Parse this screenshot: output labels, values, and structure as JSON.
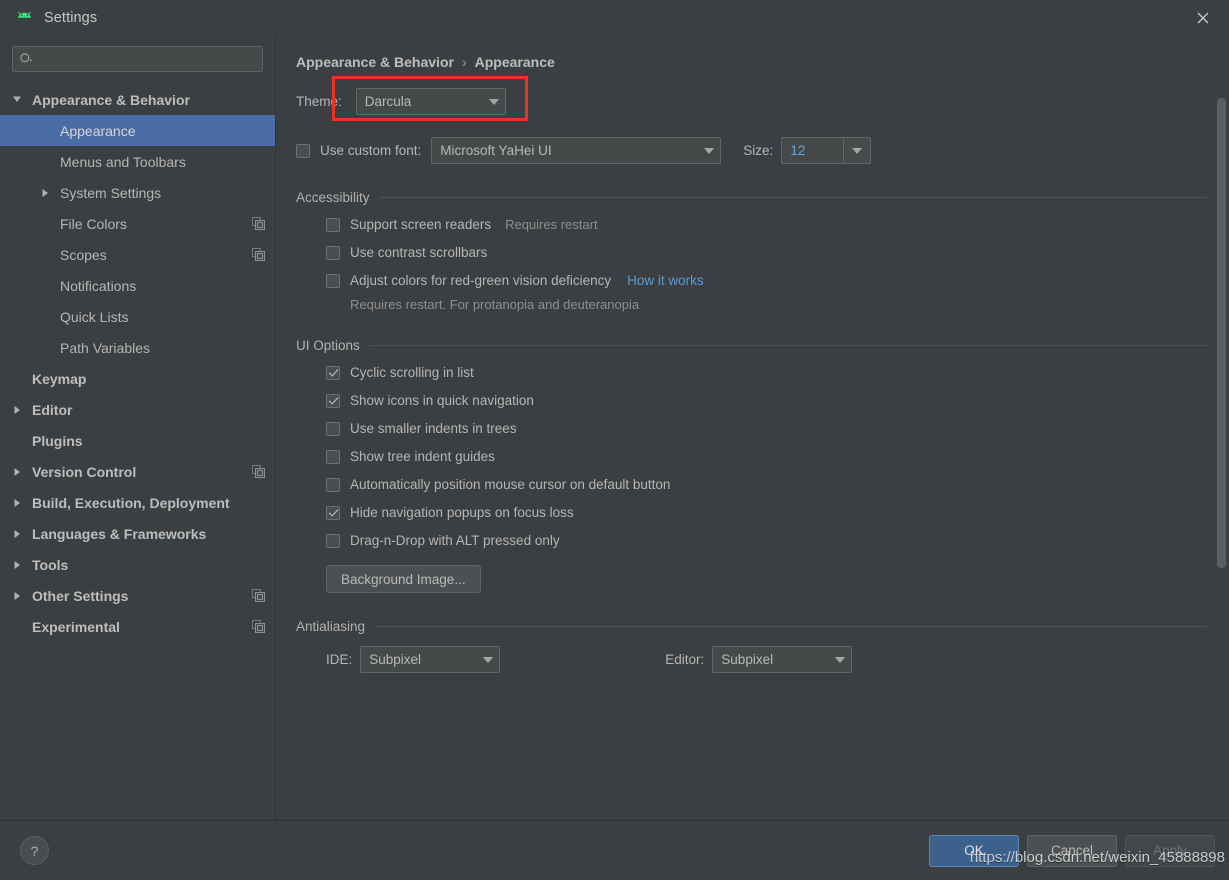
{
  "window": {
    "title": "Settings",
    "app_icon": "android-robot-icon",
    "close_icon": "close-icon"
  },
  "search": {
    "placeholder": "",
    "value": "",
    "icon": "search-icon"
  },
  "sidebar": {
    "items": [
      {
        "label": "Appearance & Behavior",
        "indent": 0,
        "twisty": "expanded",
        "bold": true,
        "selected": false,
        "trailing_icon": ""
      },
      {
        "label": "Appearance",
        "indent": 1,
        "twisty": "none",
        "bold": false,
        "selected": true,
        "trailing_icon": ""
      },
      {
        "label": "Menus and Toolbars",
        "indent": 1,
        "twisty": "none",
        "bold": false,
        "selected": false,
        "trailing_icon": ""
      },
      {
        "label": "System Settings",
        "indent": 1,
        "twisty": "collapsed",
        "bold": false,
        "selected": false,
        "trailing_icon": ""
      },
      {
        "label": "File Colors",
        "indent": 1,
        "twisty": "none",
        "bold": false,
        "selected": false,
        "trailing_icon": "copy-icon"
      },
      {
        "label": "Scopes",
        "indent": 1,
        "twisty": "none",
        "bold": false,
        "selected": false,
        "trailing_icon": "copy-icon"
      },
      {
        "label": "Notifications",
        "indent": 1,
        "twisty": "none",
        "bold": false,
        "selected": false,
        "trailing_icon": ""
      },
      {
        "label": "Quick Lists",
        "indent": 1,
        "twisty": "none",
        "bold": false,
        "selected": false,
        "trailing_icon": ""
      },
      {
        "label": "Path Variables",
        "indent": 1,
        "twisty": "none",
        "bold": false,
        "selected": false,
        "trailing_icon": ""
      },
      {
        "label": "Keymap",
        "indent": 0,
        "twisty": "none",
        "bold": true,
        "selected": false,
        "trailing_icon": ""
      },
      {
        "label": "Editor",
        "indent": 0,
        "twisty": "collapsed",
        "bold": true,
        "selected": false,
        "trailing_icon": ""
      },
      {
        "label": "Plugins",
        "indent": 0,
        "twisty": "none",
        "bold": true,
        "selected": false,
        "trailing_icon": ""
      },
      {
        "label": "Version Control",
        "indent": 0,
        "twisty": "collapsed",
        "bold": true,
        "selected": false,
        "trailing_icon": "copy-icon"
      },
      {
        "label": "Build, Execution, Deployment",
        "indent": 0,
        "twisty": "collapsed",
        "bold": true,
        "selected": false,
        "trailing_icon": ""
      },
      {
        "label": "Languages & Frameworks",
        "indent": 0,
        "twisty": "collapsed",
        "bold": true,
        "selected": false,
        "trailing_icon": ""
      },
      {
        "label": "Tools",
        "indent": 0,
        "twisty": "collapsed",
        "bold": true,
        "selected": false,
        "trailing_icon": ""
      },
      {
        "label": "Other Settings",
        "indent": 0,
        "twisty": "collapsed",
        "bold": true,
        "selected": false,
        "trailing_icon": "copy-icon"
      },
      {
        "label": "Experimental",
        "indent": 0,
        "twisty": "none",
        "bold": true,
        "selected": false,
        "trailing_icon": "copy-icon"
      }
    ]
  },
  "main": {
    "breadcrumb": {
      "parent": "Appearance & Behavior",
      "separator": "›",
      "current": "Appearance"
    },
    "theme": {
      "label": "Theme:",
      "value": "Darcula",
      "highlight_color": "#ee3124"
    },
    "custom_font": {
      "checkbox_label": "Use custom font:",
      "checked": false,
      "font_value": "Microsoft YaHei UI",
      "size_label": "Size:",
      "size_value": "12"
    },
    "accessibility": {
      "title": "Accessibility",
      "options": [
        {
          "label": "Support screen readers",
          "checked": false,
          "hint": "Requires restart",
          "link": ""
        },
        {
          "label": "Use contrast scrollbars",
          "checked": false,
          "hint": "",
          "link": ""
        },
        {
          "label": "Adjust colors for red-green vision deficiency",
          "checked": false,
          "hint": "",
          "link": "How it works"
        }
      ],
      "note": "Requires restart. For protanopia and deuteranopia",
      "link_color": "#599bd6"
    },
    "ui_options": {
      "title": "UI Options",
      "options": [
        {
          "label": "Cyclic scrolling in list",
          "checked": true
        },
        {
          "label": "Show icons in quick navigation",
          "checked": true
        },
        {
          "label": "Use smaller indents in trees",
          "checked": false
        },
        {
          "label": "Show tree indent guides",
          "checked": false
        },
        {
          "label": "Automatically position mouse cursor on default button",
          "checked": false
        },
        {
          "label": "Hide navigation popups on focus loss",
          "checked": true
        },
        {
          "label": "Drag-n-Drop with ALT pressed only",
          "checked": false
        }
      ],
      "background_image_button": "Background Image..."
    },
    "antialiasing": {
      "title": "Antialiasing",
      "ide_label": "IDE:",
      "ide_value": "Subpixel",
      "editor_label": "Editor:",
      "editor_value": "Subpixel"
    }
  },
  "footer": {
    "help_label": "?",
    "ok_label": "OK",
    "cancel_label": "Cancel",
    "apply_label": "Apply",
    "apply_disabled": true,
    "ok_color": "#3c618c"
  },
  "watermark": {
    "text": "https://blog.csdn.net/weixin_45888898"
  }
}
